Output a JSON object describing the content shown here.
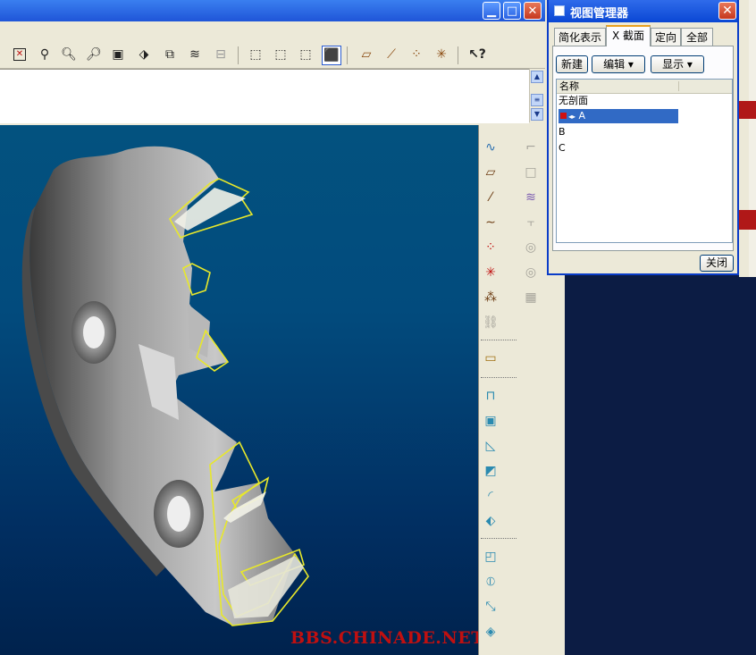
{
  "toolbar": {
    "buttons": [
      "repaint-icon",
      "spin-center-icon",
      "zoom-in-icon",
      "zoom-out-icon",
      "refit-icon",
      "orient-icon",
      "saved-views-icon",
      "layers-icon",
      "model-tree-icon",
      "wireframe-icon",
      "hidden-line-icon",
      "no-hidden-icon",
      "shading-icon",
      "datum-planes-icon",
      "datum-axes-icon",
      "datum-points-icon",
      "coord-sys-icon",
      "help-icon"
    ]
  },
  "dialog": {
    "title": "视图管理器",
    "tabs": [
      "简化表示",
      "X 截面",
      "定向",
      "全部"
    ],
    "active_tab": "X 截面",
    "buttons": {
      "new": "新建",
      "edit": "编辑",
      "display": "显示"
    },
    "list_header": "名称",
    "rows": [
      {
        "label": "无剖面",
        "selected": false
      },
      {
        "label": "A",
        "selected": true
      },
      {
        "label": "B",
        "selected": false
      },
      {
        "label": "C",
        "selected": false
      }
    ],
    "close": "关闭"
  },
  "watermark": "BBS.CHINADE.NET",
  "colors": {
    "viewport_top": "#03527f",
    "viewport_bottom": "#00224d",
    "section_edge": "#e8e82a",
    "watermark": "#c01010",
    "selection": "#316ac5"
  }
}
